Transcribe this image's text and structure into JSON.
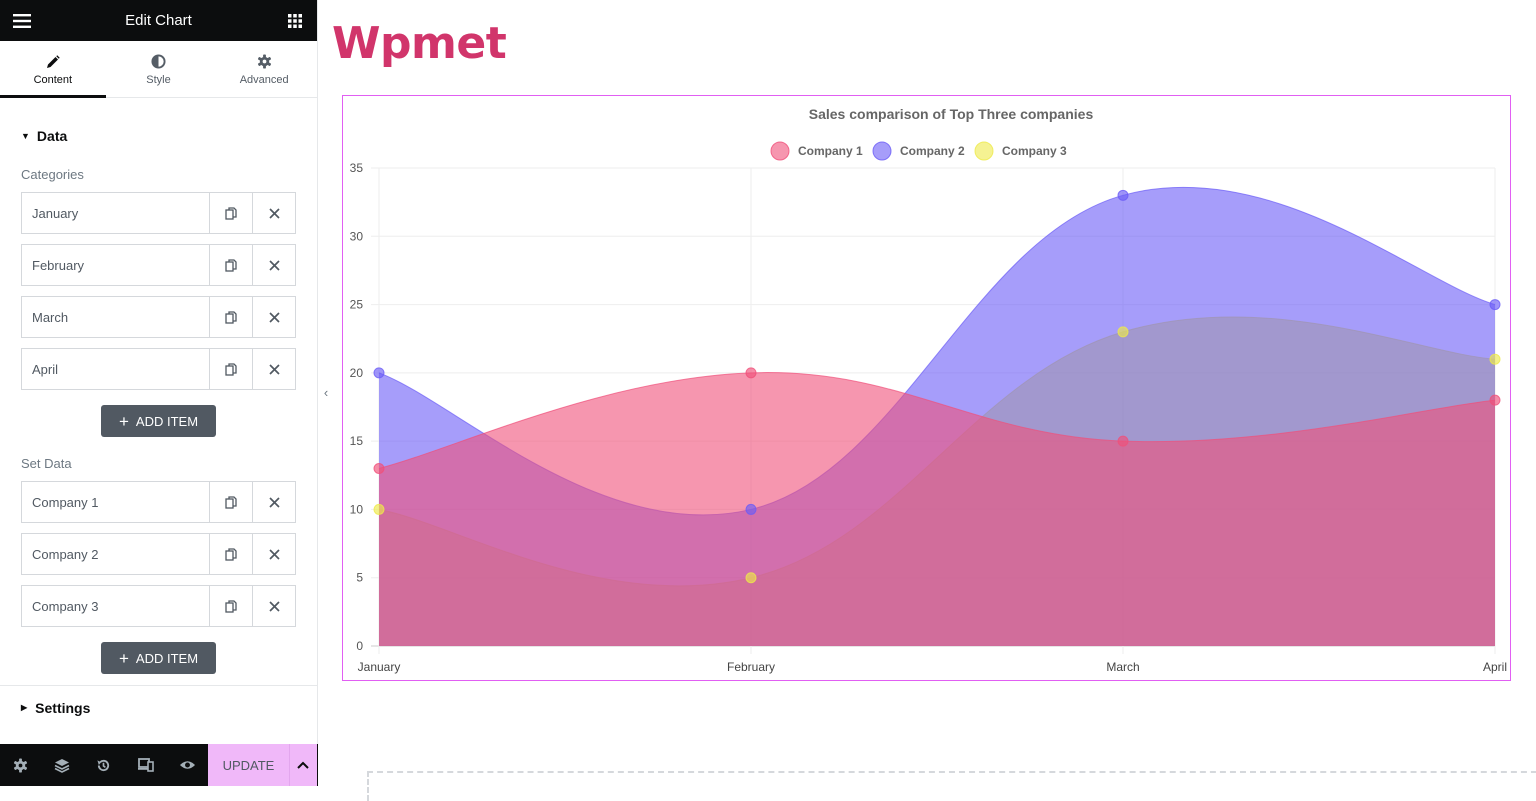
{
  "editor": {
    "title": "Edit Chart",
    "tabs": [
      {
        "label": "Content",
        "icon": "pencil-icon",
        "active": true
      },
      {
        "label": "Style",
        "icon": "half-circle-icon",
        "active": false
      },
      {
        "label": "Advanced",
        "icon": "gear-icon",
        "active": false
      }
    ],
    "data_section": "Data",
    "categories_label": "Categories",
    "categories": [
      "January",
      "February",
      "March",
      "April"
    ],
    "add_item_label": "ADD ITEM",
    "set_data_label": "Set Data",
    "datasets": [
      "Company 1",
      "Company 2",
      "Company 3"
    ],
    "settings_section": "Settings",
    "update_label": "UPDATE"
  },
  "page": {
    "heading": "Wpmet",
    "heading_color": "#d1356b"
  },
  "chart_data": {
    "type": "area",
    "title": "Sales comparison of Top Three companies",
    "categories": [
      "January",
      "February",
      "March",
      "April"
    ],
    "series": [
      {
        "name": "Company 1",
        "values": [
          13,
          20,
          15,
          18
        ],
        "color": "#f0507a"
      },
      {
        "name": "Company 2",
        "values": [
          20,
          10,
          33,
          25
        ],
        "color": "#6b5cf6"
      },
      {
        "name": "Company 3",
        "values": [
          10,
          5,
          23,
          21
        ],
        "color": "#eeea4a"
      }
    ],
    "ylim": [
      0,
      35
    ],
    "yticks": [
      0,
      5,
      10,
      15,
      20,
      25,
      30,
      35
    ],
    "xlabel": "",
    "ylabel": "",
    "grid": true,
    "legend": "top-center",
    "curve": "smooth"
  }
}
